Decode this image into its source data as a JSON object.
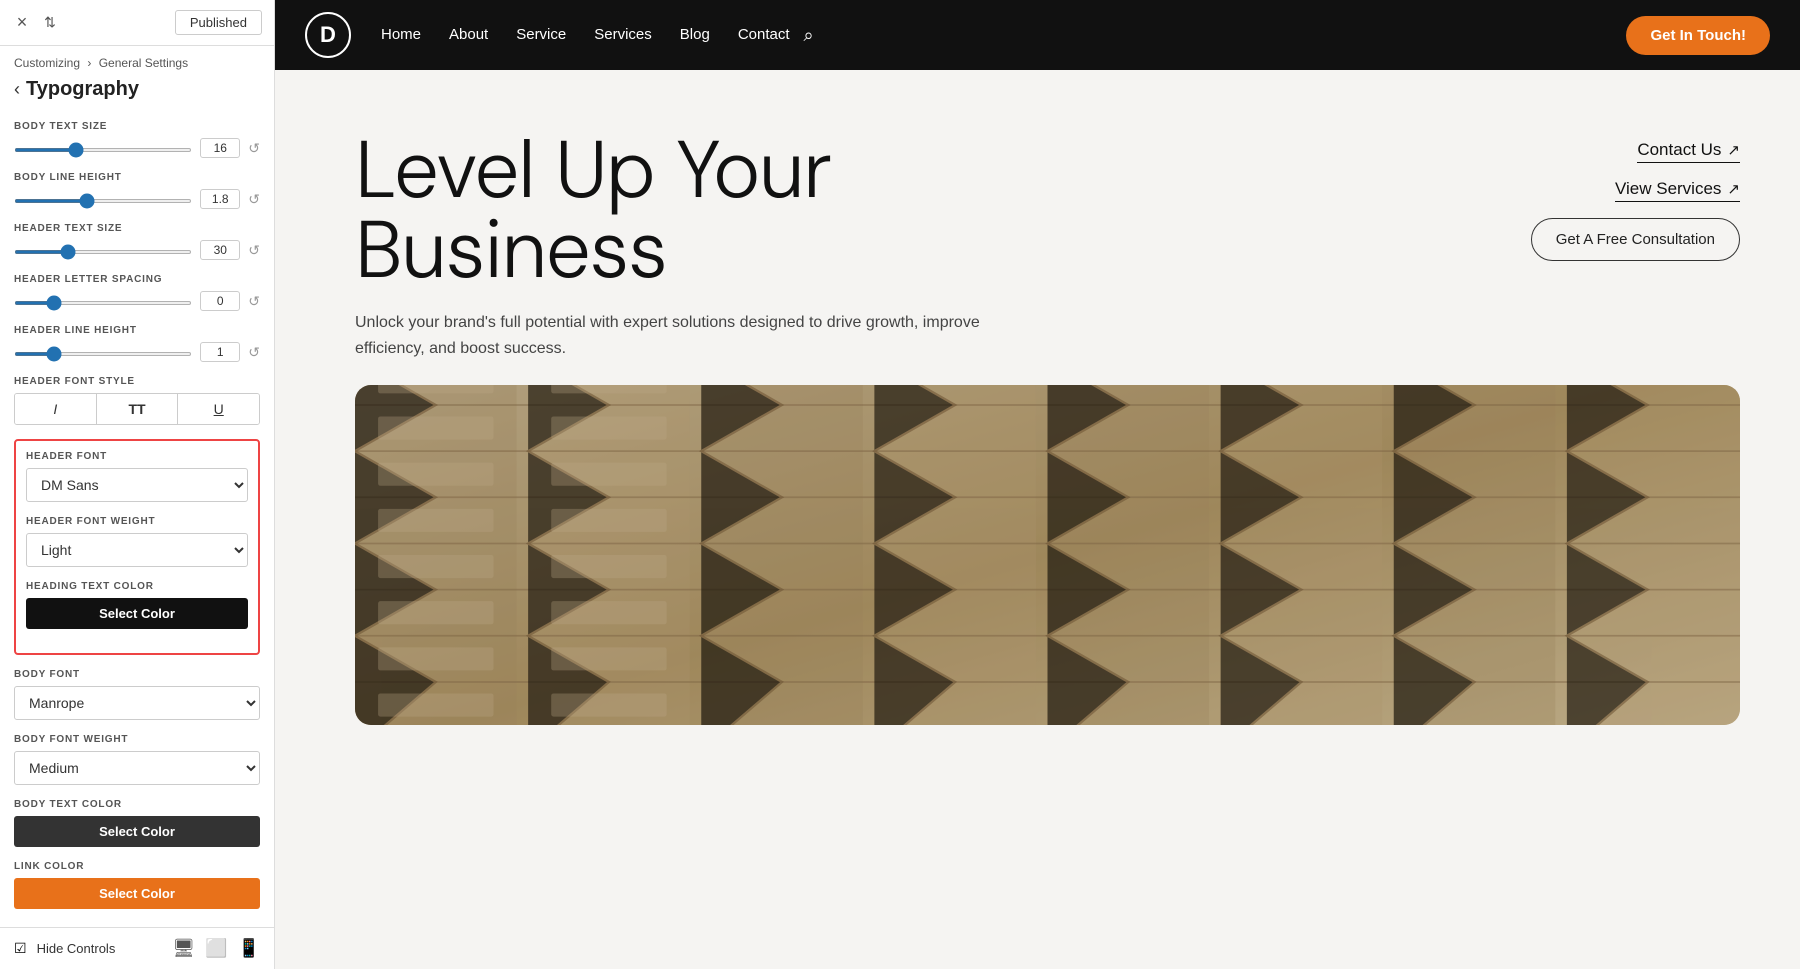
{
  "topbar": {
    "close_label": "×",
    "swap_label": "⇅",
    "published_label": "Published"
  },
  "breadcrumb": {
    "parent": "Customizing",
    "separator": "›",
    "section": "General Settings"
  },
  "panel": {
    "back_arrow": "‹",
    "title": "Typography"
  },
  "settings": {
    "body_text_size_label": "BODY TEXT SIZE",
    "body_text_size_value": "16",
    "body_line_height_label": "BODY LINE HEIGHT",
    "body_line_height_value": "1.8",
    "header_text_size_label": "HEADER TEXT SIZE",
    "header_text_size_value": "30",
    "header_letter_spacing_label": "HEADER LETTER SPACING",
    "header_letter_spacing_value": "0",
    "header_line_height_label": "HEADER LINE HEIGHT",
    "header_line_height_value": "1",
    "header_font_style_label": "HEADER FONT STYLE",
    "style_italic": "I",
    "style_bold": "TT",
    "style_underline": "U",
    "header_font_label": "HEADER FONT",
    "header_font_value": "DM Sans",
    "header_font_weight_label": "HEADER FONT WEIGHT",
    "header_font_weight_value": "Light",
    "heading_text_color_label": "HEADING TEXT COLOR",
    "heading_color_btn_label": "Select Color",
    "body_font_label": "BODY FONT",
    "body_font_value": "Manrope",
    "body_font_weight_label": "BODY FONT WEIGHT",
    "body_font_weight_value": "Medium",
    "body_text_color_label": "BODY TEXT COLOR",
    "body_color_btn_label": "Select Color",
    "link_color_label": "LINK COLOR",
    "link_color_btn_label": "Select Color"
  },
  "footer": {
    "hide_controls_label": "Hide Controls",
    "desktop_icon": "🖥",
    "tablet_icon": "⬜",
    "mobile_icon": "📱"
  },
  "nav": {
    "logo_letter": "D",
    "links": [
      "Home",
      "About",
      "Service",
      "Services",
      "Blog",
      "Contact"
    ],
    "search_icon": "🔍",
    "cta_label": "Get In Touch!"
  },
  "hero": {
    "heading_line1": "Level Up Your",
    "heading_line2": "Business",
    "subtext": "Unlock your brand's full potential with expert solutions designed to drive growth, improve efficiency, and boost success.",
    "cta1_label": "Contact Us",
    "cta1_arrow": "↗",
    "cta2_label": "View Services",
    "cta2_arrow": "↗",
    "cta3_label": "Get A Free Consultation"
  }
}
